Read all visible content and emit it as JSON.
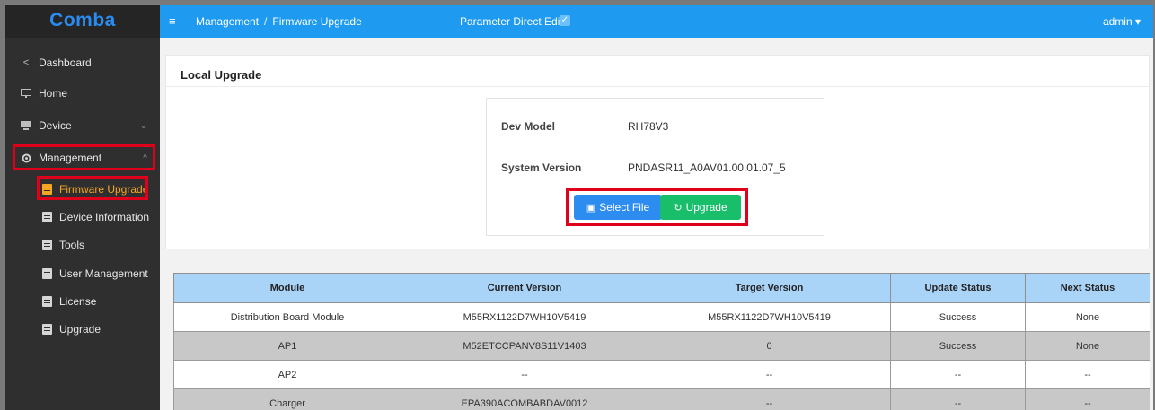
{
  "sidebar": {
    "logo": "Comba",
    "items": [
      {
        "label": "Dashboard",
        "icon": "share-icon"
      },
      {
        "label": "Home",
        "icon": "monitor-icon"
      },
      {
        "label": "Device",
        "icon": "device-icon"
      },
      {
        "label": "Management",
        "icon": "gear-icon"
      }
    ],
    "sub_items": [
      {
        "label": "Firmware Upgrade"
      },
      {
        "label": "Device Information"
      },
      {
        "label": "Tools"
      },
      {
        "label": "User Management"
      },
      {
        "label": "License"
      },
      {
        "label": "Upgrade"
      }
    ]
  },
  "header": {
    "breadcrumb": [
      "Management",
      "Firmware Upgrade"
    ],
    "separator": "/",
    "param_edit": "Parameter Direct Edit",
    "param_edit_checked": true,
    "user": "admin"
  },
  "panel": {
    "title": "Local Upgrade",
    "dev_model_label": "Dev Model",
    "dev_model_value": "RH78V3",
    "system_version_label": "System Version",
    "system_version_value": "PNDASR11_A0AV01.00.01.07_5",
    "select_file_label": "Select File",
    "upgrade_label": "Upgrade"
  },
  "table": {
    "headers": [
      "Module",
      "Current Version",
      "Target Version",
      "Update Status",
      "Next Status"
    ],
    "rows": [
      [
        "Distribution Board Module",
        "M55RX1122D7WH10V5419",
        "M55RX1122D7WH10V5419",
        "Success",
        "None"
      ],
      [
        "AP1",
        "M52ETCCPANV8S11V1403",
        "0",
        "Success",
        "None"
      ],
      [
        "AP2",
        "--",
        "--",
        "--",
        "--"
      ],
      [
        "Charger",
        "EPA390ACOMBABDAV0012",
        "--",
        "--",
        "--"
      ]
    ]
  },
  "colors": {
    "header_blue": "#1e9bf0",
    "sidebar_bg": "#2f2f2f",
    "active_orange": "#f5a623",
    "select_btn": "#2d8cf0",
    "upgrade_btn": "#19be6b",
    "highlight_red": "#e0001b"
  }
}
